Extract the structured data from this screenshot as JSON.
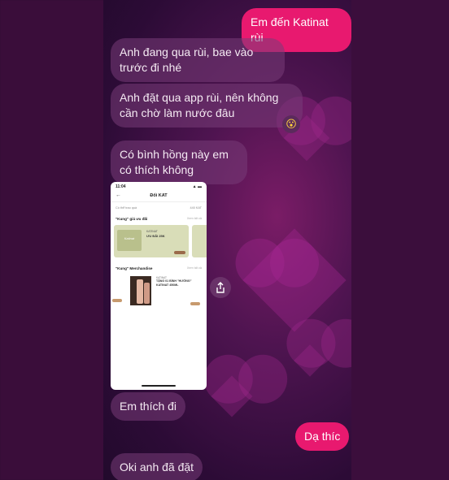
{
  "chat": {
    "messages": [
      {
        "text": "Em đến Katinat rùi",
        "from": "me"
      },
      {
        "text": "Anh đang qua rùi, bae vào trước đi nhé",
        "from": "other"
      },
      {
        "text": "Anh đặt qua app rùi, nên không cần chờ làm nước đâu",
        "from": "other"
      },
      {
        "text": "Có bình hồng này em có thích không",
        "from": "other"
      },
      {
        "text": "Em thích đi",
        "from": "other"
      },
      {
        "text": "Dạ thíc",
        "from": "me"
      },
      {
        "text": "Oki anh đã đặt",
        "from": "other"
      }
    ],
    "reaction": "😮",
    "share_icon": "share-icon"
  },
  "shared_screenshot": {
    "time": "11:04",
    "status_icons": "▲ ▬",
    "back_icon": "←",
    "title": "Đổi KAT",
    "filter_label": "Có thể trao quà",
    "filter_value": "440 KAT",
    "section1_title": "\"Kung\" giá ưu đãi",
    "section1_more": "Xem tất cả",
    "card1_brand": "KATINAT",
    "card1_offer": "ƯU ĐÃI 25K",
    "card1_logo": "Katinat",
    "section2_title": "\"Kung\" Merchandise",
    "section2_more": "Xem tất cả",
    "card2_brand": "KATINAT",
    "card2_offer": "TẶNG 01 BÌNH \"HƯỚNG\" KATINAT 450ML"
  },
  "colors": {
    "outgoing_bubble": "#e8196f",
    "incoming_bubble": "#783c78",
    "background": "#4e1450"
  }
}
